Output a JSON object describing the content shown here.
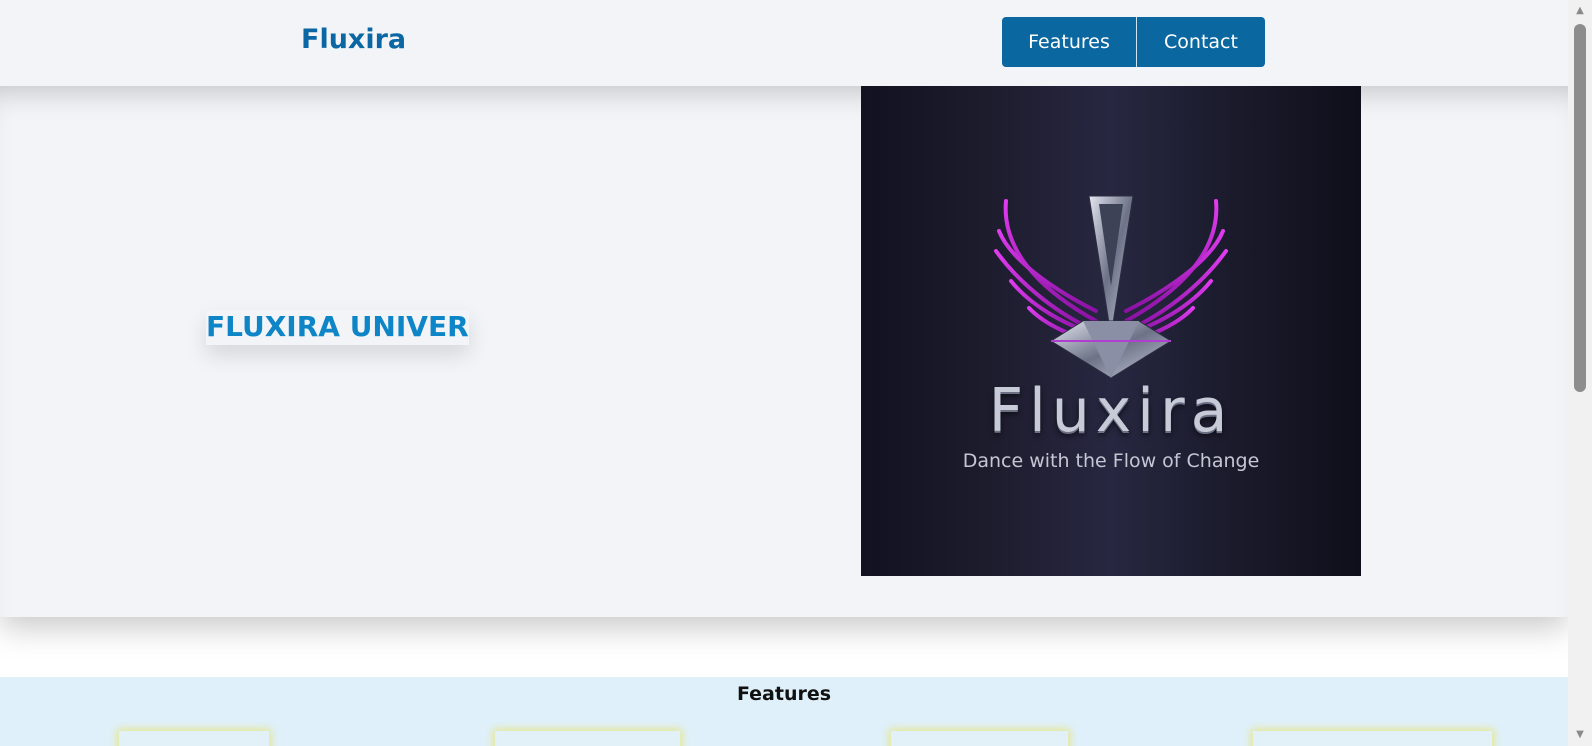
{
  "header": {
    "brand": "Fluxira",
    "nav": [
      {
        "label": "Features"
      },
      {
        "label": "Contact"
      }
    ]
  },
  "hero": {
    "title": "FLUXIRA UNIVER",
    "logo": {
      "wordmark": "Fluxira",
      "tagline": "Dance with the Flow of Change"
    }
  },
  "features": {
    "heading": "Features"
  },
  "colors": {
    "brand": "#0b66a4",
    "nav_bg": "#0a679f",
    "hero_title": "#0d85c6",
    "page_bg": "#f2f4f7",
    "features_bg": "#dff0fb",
    "logo_magenta": "#c21fd6"
  }
}
